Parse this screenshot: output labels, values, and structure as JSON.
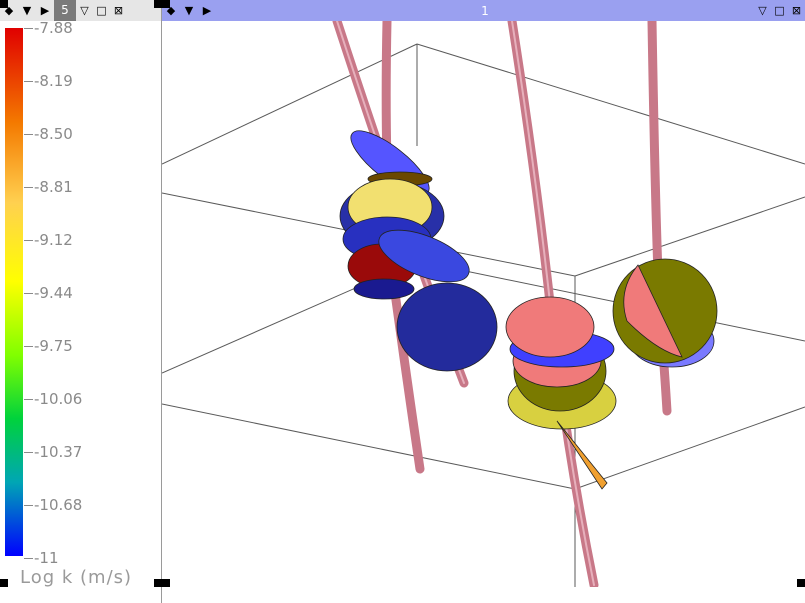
{
  "left_panel": {
    "title": {
      "number": "5",
      "buttons": [
        "◆",
        "▼",
        "▶"
      ],
      "right_buttons": [
        "▽",
        "□",
        "⊠"
      ]
    },
    "legend": {
      "title": "Log k (m/s)",
      "ticks": [
        "-7.88",
        "-8.19",
        "-8.50",
        "-8.81",
        "-9.12",
        "-9.44",
        "-9.75",
        "-10.06",
        "-10.37",
        "-10.68",
        "-11"
      ],
      "colors": {
        "max": "#e00000",
        "mid": "#ffff00",
        "min": "#0000ff"
      }
    }
  },
  "right_panel": {
    "title": {
      "number": "1",
      "buttons": [
        "◆",
        "▼",
        "▶"
      ],
      "right_buttons": [
        "▽",
        "□",
        "⊠"
      ]
    },
    "scene": {
      "borehole_color": "#c87888",
      "box_line_color": "#555555"
    }
  }
}
